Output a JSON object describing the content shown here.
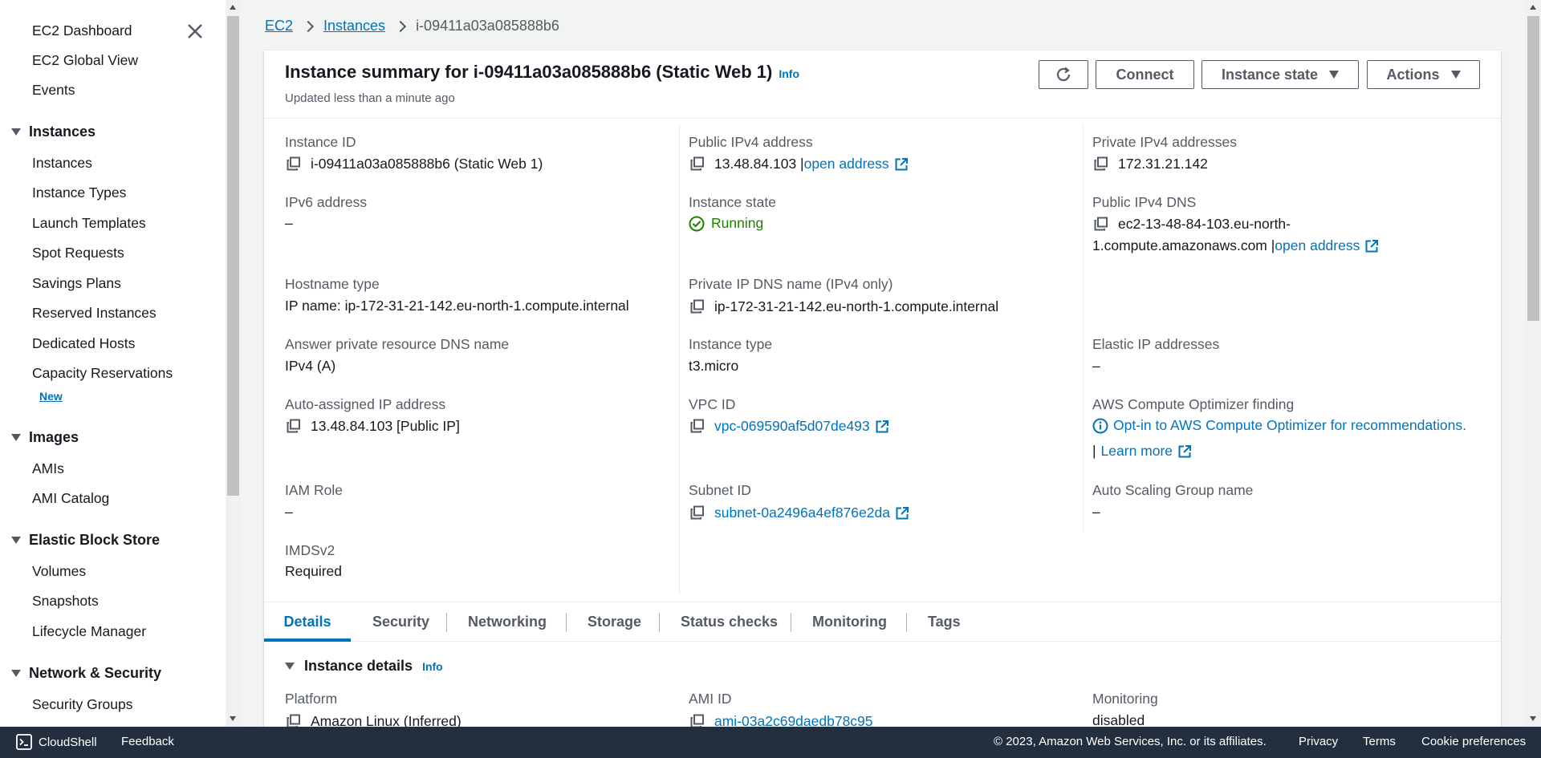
{
  "sidebar": {
    "top_items": [
      "EC2 Dashboard",
      "EC2 Global View",
      "Events"
    ],
    "sections": [
      {
        "title": "Instances",
        "items": [
          "Instances",
          "Instance Types",
          "Launch Templates",
          "Spot Requests",
          "Savings Plans",
          "Reserved Instances",
          "Dedicated Hosts",
          "Capacity Reservations"
        ],
        "badge": "New"
      },
      {
        "title": "Images",
        "items": [
          "AMIs",
          "AMI Catalog"
        ]
      },
      {
        "title": "Elastic Block Store",
        "items": [
          "Volumes",
          "Snapshots",
          "Lifecycle Manager"
        ]
      },
      {
        "title": "Network & Security",
        "items": [
          "Security Groups"
        ]
      }
    ]
  },
  "breadcrumb": {
    "ec2": "EC2",
    "instances": "Instances",
    "current": "i-09411a03a085888b6"
  },
  "summary": {
    "title": "Instance summary for i-09411a03a085888b6 (Static Web 1)",
    "info": "Info",
    "updated": "Updated less than a minute ago"
  },
  "buttons": {
    "connect": "Connect",
    "instance_state": "Instance state",
    "actions": "Actions"
  },
  "fields": {
    "instance_id_label": "Instance ID",
    "instance_id_value": "i-09411a03a085888b6 (Static Web 1)",
    "ipv6_label": "IPv6 address",
    "ipv6_value": "–",
    "hostname_type_label": "Hostname type",
    "hostname_type_value": "IP name: ip-172-31-21-142.eu-north-1.compute.internal",
    "answer_dns_label": "Answer private resource DNS name",
    "answer_dns_value": "IPv4 (A)",
    "auto_ip_label": "Auto-assigned IP address",
    "auto_ip_value": "13.48.84.103 [Public IP]",
    "iam_role_label": "IAM Role",
    "iam_role_value": "–",
    "imds_label": "IMDSv2",
    "imds_value": "Required",
    "public_ipv4_label": "Public IPv4 address",
    "public_ipv4_value": "13.48.84.103 |",
    "open_address": "open address",
    "instance_state_label": "Instance state",
    "instance_state_value": "Running",
    "private_dns_label": "Private IP DNS name (IPv4 only)",
    "private_dns_value": "ip-172-31-21-142.eu-north-1.compute.internal",
    "instance_type_label": "Instance type",
    "instance_type_value": "t3.micro",
    "vpc_label": "VPC ID",
    "vpc_value": "vpc-069590af5d07de493",
    "subnet_label": "Subnet ID",
    "subnet_value": "subnet-0a2496a4ef876e2da",
    "private_ipv4_label": "Private IPv4 addresses",
    "private_ipv4_value": "172.31.21.142",
    "public_dns_label": "Public IPv4 DNS",
    "public_dns_line1": "ec2-13-48-84-103.eu-north-",
    "public_dns_line2": "1.compute.amazonaws.com |",
    "elastic_ip_label": "Elastic IP addresses",
    "elastic_ip_value": "–",
    "optimizer_label": "AWS Compute Optimizer finding",
    "optimizer_value": "Opt-in to AWS Compute Optimizer for recommendations.",
    "learn_more_prefix": "|",
    "learn_more": "Learn more",
    "asg_label": "Auto Scaling Group name",
    "asg_value": "–"
  },
  "tabs": [
    "Details",
    "Security",
    "Networking",
    "Storage",
    "Status checks",
    "Monitoring",
    "Tags"
  ],
  "active_tab": "Details",
  "details": {
    "header": "Instance details",
    "info": "Info",
    "platform_label": "Platform",
    "platform_value": "Amazon Linux (Inferred)",
    "ami_label": "AMI ID",
    "ami_value": "ami-03a2c69daedb78c95",
    "monitoring_label": "Monitoring",
    "monitoring_value": "disabled"
  },
  "footer": {
    "cloudshell": "CloudShell",
    "feedback": "Feedback",
    "copyright": "© 2023, Amazon Web Services, Inc. or its affiliates.",
    "privacy": "Privacy",
    "terms": "Terms",
    "cookies": "Cookie preferences"
  },
  "colors": {
    "link": "#0073bb",
    "running": "#1d8102",
    "footer_bg": "#232f3e"
  }
}
